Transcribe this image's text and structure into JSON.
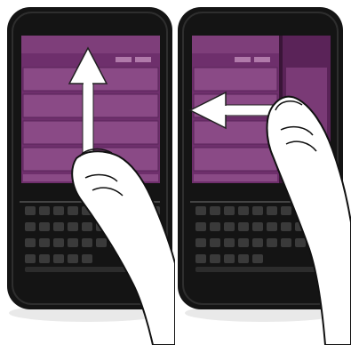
{
  "illustration": {
    "panels": [
      {
        "gesture": "swipe-up",
        "arrow_direction": "up",
        "screen_view": "list"
      },
      {
        "gesture": "swipe-left",
        "arrow_direction": "left",
        "screen_view": "list-with-side-panel"
      }
    ],
    "colors": {
      "device_body": "#141414",
      "bezel": "#2a2a2a",
      "screen_purple": "#7a3a78",
      "screen_purple_dark": "#4e1f4c",
      "list_row": "#8a4a86",
      "arrow": "#ffffff",
      "key": "#3a3a3a",
      "hand_fill": "#ffffff",
      "hand_stroke": "#111111"
    }
  }
}
